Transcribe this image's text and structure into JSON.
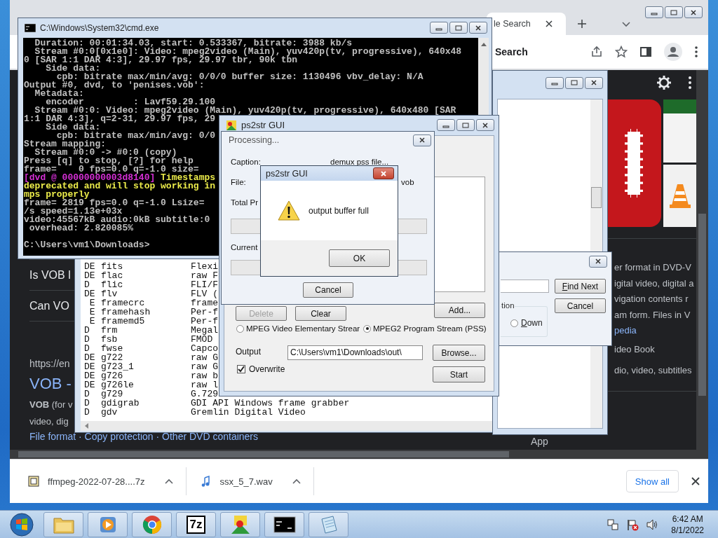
{
  "browser": {
    "tab_title": "le Search",
    "omnibox_text": "Search",
    "page": {
      "questions": [
        "Is VOB l",
        "Can VO"
      ],
      "result_url": "https://en",
      "result_title": "VOB -",
      "snippet_lines": [
        "**VOB** (for v",
        "video, dig"
      ],
      "sitelinks": "File format · Copy protection · Other DVD containers",
      "panel_lines": [
        "er format in DVD-V",
        "igital video, digital a",
        "vigation contents r",
        "am form. Files in V"
      ],
      "panel_link": "pedia",
      "panel_facts": [
        "ideo Book",
        "dio, video, subtitles"
      ],
      "app_label": "App"
    },
    "downloads": [
      {
        "name": "ffmpeg-2022-07-28....7z",
        "kind": "archive"
      },
      {
        "name": "ssx_5_7.wav",
        "kind": "audio"
      }
    ],
    "show_all": "Show all"
  },
  "listing": {
    "rows": [
      {
        "flags": "DE",
        "name": "fits",
        "description": "Flexi"
      },
      {
        "flags": "DE",
        "name": "flac",
        "description": "raw F"
      },
      {
        "flags": "D",
        "name": "flic",
        "description": "FLI/F"
      },
      {
        "flags": "DE",
        "name": "flv",
        "description": "FLV ("
      },
      {
        "flags": " E",
        "name": "framecrc",
        "description": "frame"
      },
      {
        "flags": " E",
        "name": "framehash",
        "description": "Per-f"
      },
      {
        "flags": " E",
        "name": "framemd5",
        "description": "Per-f"
      },
      {
        "flags": "D",
        "name": "frm",
        "description": "Megal"
      },
      {
        "flags": "D",
        "name": "fsb",
        "description": "FMOD"
      },
      {
        "flags": "D",
        "name": "fwse",
        "description": "Capco"
      },
      {
        "flags": "DE",
        "name": "g722",
        "description": "raw G"
      },
      {
        "flags": "DE",
        "name": "g723_1",
        "description": "raw G"
      },
      {
        "flags": "DE",
        "name": "g726",
        "description": "raw b"
      },
      {
        "flags": "DE",
        "name": "g726le",
        "description": "raw l"
      },
      {
        "flags": "D",
        "name": "g729",
        "description": "G.729"
      },
      {
        "flags": "D",
        "name": "gdigrab",
        "description": "GDI API Windows frame grabber"
      },
      {
        "flags": "D",
        "name": "gdv",
        "description": "Gremlin Digital Video"
      }
    ]
  },
  "find_dialog": {
    "direction_label": "tion",
    "directions": [
      {
        "label": "Down",
        "selected": false
      }
    ],
    "find_next": "Find Next",
    "cancel": "Cancel"
  },
  "cmd": {
    "title": "C:\\Windows\\System32\\cmd.exe",
    "lines": [
      {
        "kind": "plain",
        "text": "  Duration: 00:01:34.03, start: 0.533367, bitrate: 3988 kb/s"
      },
      {
        "kind": "plain",
        "text": "  Stream #0:0[0x1e0]: Video: mpeg2video (Main), yuv420p(tv, progressive), 640x48"
      },
      {
        "kind": "plain",
        "text": "0 [SAR 1:1 DAR 4:3], 29.97 fps, 29.97 tbr, 90k tbn"
      },
      {
        "kind": "plain",
        "text": "    Side data:"
      },
      {
        "kind": "plain",
        "text": "      cpb: bitrate max/min/avg: 0/0/0 buffer size: 1130496 vbv_delay: N/A"
      },
      {
        "kind": "plain",
        "text": "Output #0, dvd, to 'penises.vob':"
      },
      {
        "kind": "plain",
        "text": "  Metadata:"
      },
      {
        "kind": "plain",
        "text": "    encoder         : Lavf59.29.100"
      },
      {
        "kind": "plain",
        "text": "  Stream #0:0: Video: mpeg2video (Main), yuv420p(tv, progressive), 640x480 [SAR"
      },
      {
        "kind": "plain",
        "text": "1:1 DAR 4:3], q=2-31, 29.97 fps, 29"
      },
      {
        "kind": "plain",
        "text": "    Side data:"
      },
      {
        "kind": "plain",
        "text": "      cpb: bitrate max/min/avg: 0/0"
      },
      {
        "kind": "plain",
        "text": "Stream mapping:"
      },
      {
        "kind": "plain",
        "text": "  Stream #0:0 -> #0:0 (copy)"
      },
      {
        "kind": "plain",
        "text": "Press [q] to stop, [?] for help"
      },
      {
        "kind": "plain",
        "text": "frame=    0 fps=0.0 q=-1.0 size="
      },
      {
        "kind": "tagged",
        "tag": "[dvd @ 00000000003d8140]",
        "text": " Timestamps"
      },
      {
        "kind": "warning",
        "text": "deprecated and will stop working in"
      },
      {
        "kind": "warning",
        "text": "mps properly"
      },
      {
        "kind": "plain",
        "text": "frame= 2819 fps=0.0 q=-1.0 Lsize="
      },
      {
        "kind": "plain",
        "text": "/s speed=1.13e+03x"
      },
      {
        "kind": "plain",
        "text": "video:45567kB audio:0kB subtitle:0"
      },
      {
        "kind": "plain",
        "text": " overhead: 2.820085%"
      },
      {
        "kind": "prompt",
        "text": "C:\\Users\\vm1\\Downloads>"
      }
    ]
  },
  "ps2str": {
    "title": "ps2str GUI",
    "buttons": [
      {
        "label": "Delete",
        "disabled": true
      },
      {
        "label": "Clear",
        "disabled": false
      }
    ],
    "add": "Add...",
    "modes": [
      {
        "label": "MPEG Video Elementary Strear",
        "selected": false
      },
      {
        "label": "MPEG2 Program Stream (PSS)",
        "selected": true
      }
    ],
    "output_label": "Output",
    "output_value": "C:\\Users\\vm1\\Downloads\\out\\",
    "browse": "Browse...",
    "overwrite": {
      "label": "Overwrite",
      "checked": true
    },
    "start": "Start"
  },
  "processing": {
    "title": "Processing...",
    "fields": [
      {
        "label": "Caption:",
        "value": "demux pss file..."
      },
      {
        "label": "File:",
        "value": "vob"
      }
    ],
    "progress": [
      {
        "label": "Total Pr",
        "level": 0
      },
      {
        "label": "Current",
        "level": 0
      }
    ],
    "cancel": "Cancel"
  },
  "alert": {
    "title": "ps2str GUI",
    "message": "output buffer full",
    "ok": "OK"
  },
  "taskbar": {
    "apps": [
      {
        "kind": "explorer"
      },
      {
        "kind": "media"
      },
      {
        "kind": "chrome"
      },
      {
        "kind": "archiver",
        "label": "7z"
      },
      {
        "kind": "ps2str"
      },
      {
        "kind": "console"
      },
      {
        "kind": "notepad"
      }
    ],
    "time": "6:42 AM",
    "date": "8/1/2022"
  }
}
